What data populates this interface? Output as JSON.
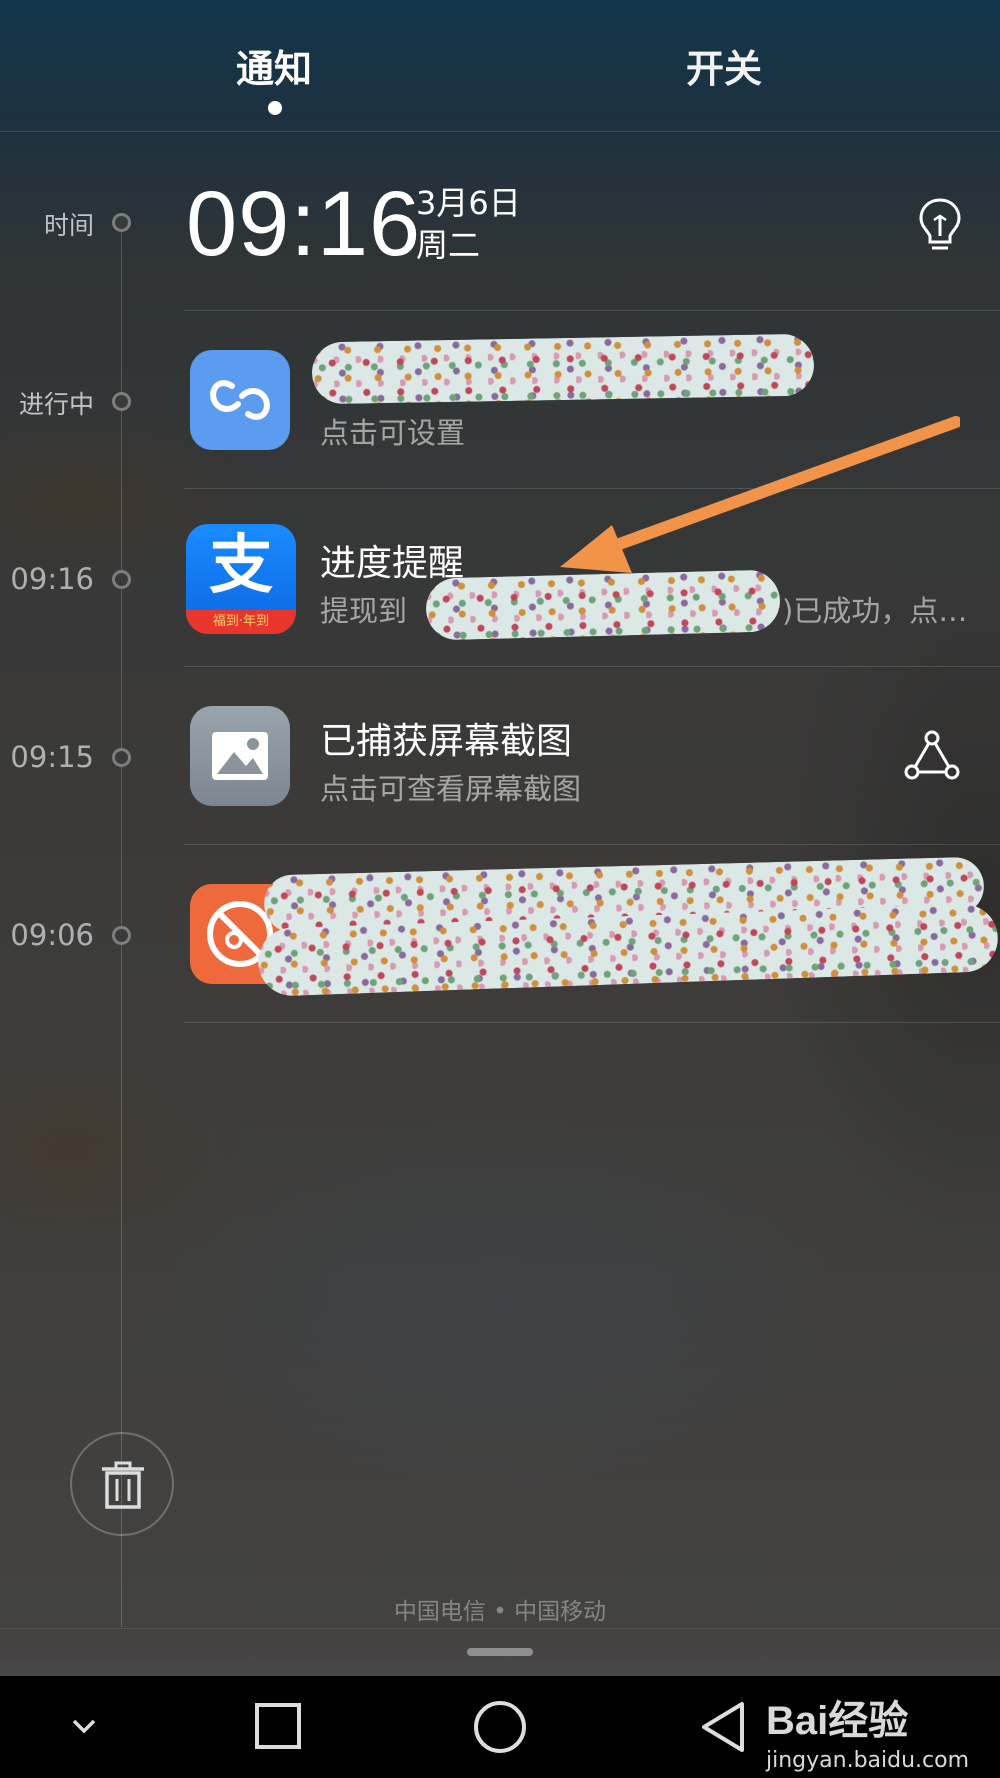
{
  "tabs": {
    "notify": "通知",
    "switches": "开关"
  },
  "timeline": {
    "time_label": "时间",
    "ongoing_label": "进行中",
    "times": [
      "09:16",
      "09:15",
      "09:06"
    ]
  },
  "header": {
    "clock": "09:16",
    "date": "3月6日",
    "weekday": "周二"
  },
  "notifications": [
    {
      "app": "link-app",
      "title": "",
      "subtitle": "点击可设置"
    },
    {
      "app": "alipay",
      "title": "进度提醒",
      "subtitle_start": "提现到",
      "subtitle_end": ")已成功，点…",
      "icon_char": "支",
      "icon_badge": "福到·年到"
    },
    {
      "app": "screenshot",
      "title": "已捕获屏幕截图",
      "subtitle": "点击可查看屏幕截图"
    },
    {
      "app": "hidden-app",
      "title": "",
      "subtitle": ""
    }
  ],
  "footer": {
    "carrier": "中国电信 • 中国移动"
  },
  "watermark": {
    "brand": "Bai经验",
    "url": "jingyan.baidu.com"
  },
  "colors": {
    "accent_arrow": "#f2934a",
    "link_app": "#5b9bf0",
    "alipay": "#1677ff",
    "hidden_app": "#ee6a3c"
  }
}
